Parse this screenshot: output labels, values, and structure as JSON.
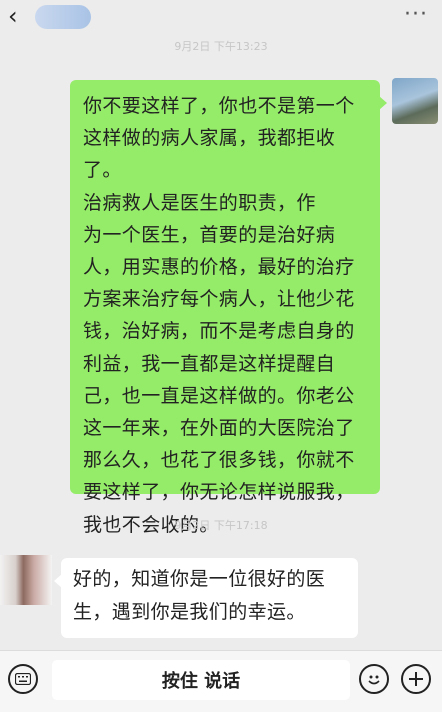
{
  "header": {
    "back_icon": "chevron-left-icon",
    "more_icon": "more-icon",
    "more_glyph": "···"
  },
  "messages": [
    {
      "timestamp": "9月2日 下午13:23"
    },
    {
      "sender": "me",
      "lines": [
        "你不要这样了，你也不是第一个",
        "这样做的病人家属，我都拒收了。",
        "治病救人是医生的职责，作",
        "为一个医生，首要的是治好病",
        "人，用实惠的价格，最好的治疗",
        "方案来治疗每个病人，让他少花",
        "钱，治好病，而不是考虑自身的",
        "利益，我一直都是这样提醒自",
        "己，也一直是这样做的。你老公",
        "这一年来，在外面的大医院治了",
        "那么久，也花了很多钱，你就不",
        "要这样了，你无论怎样说服我，",
        "我也不会收的。"
      ]
    },
    {
      "timestamp": "9月2日 下午17:18"
    },
    {
      "sender": "them",
      "lines": [
        "好的，知道你是一位很好的医",
        "生，遇到你是我们的幸运。"
      ]
    }
  ],
  "input_bar": {
    "voice_icon": "voice-keyboard-toggle-icon",
    "hold_to_talk_label": "按住 说话",
    "emoji_icon": "emoji-icon",
    "plus_icon": "plus-icon"
  },
  "colors": {
    "my_bubble": "#95ec69",
    "their_bubble": "#ffffff",
    "background": "#ececec"
  }
}
